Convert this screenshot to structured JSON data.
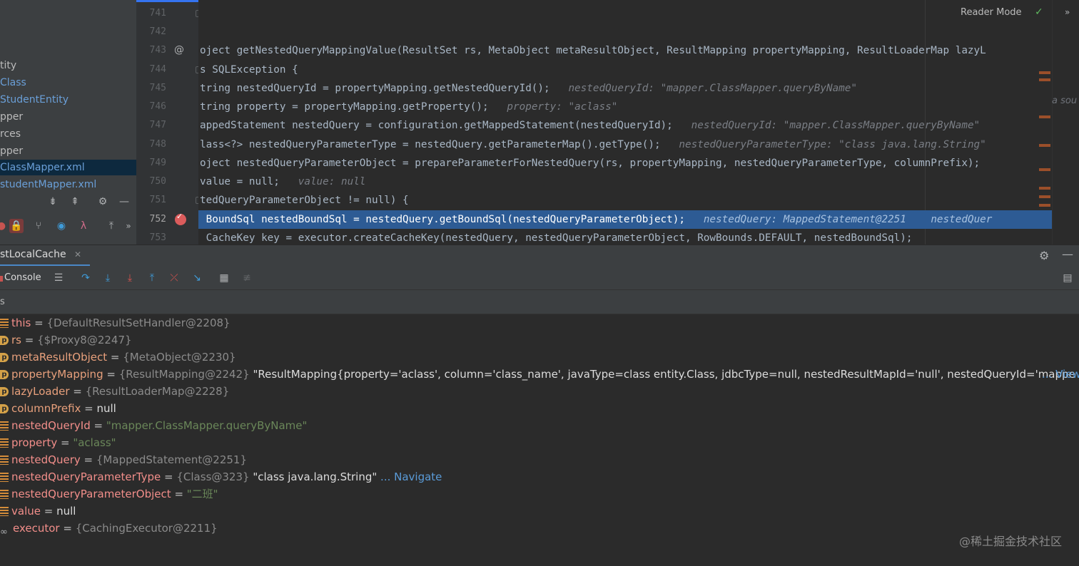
{
  "project_tree": {
    "items": [
      {
        "label": "tity",
        "kind": "plain"
      },
      {
        "label": "Class",
        "kind": "cls"
      },
      {
        "label": "StudentEntity",
        "kind": "cls"
      },
      {
        "label": "pper",
        "kind": "plain"
      },
      {
        "label": "rces",
        "kind": "plain"
      },
      {
        "label": "pper",
        "kind": "plain"
      },
      {
        "label": "ClassMapper.xml",
        "kind": "cls"
      },
      {
        "label": "studentMapper.xml",
        "kind": "cls"
      }
    ]
  },
  "editor": {
    "reader_mode": "Reader Mode",
    "right_hint": "a sou",
    "line_numbers": [
      "741",
      "742",
      "743",
      "744",
      "745",
      "746",
      "747",
      "748",
      "749",
      "750",
      "751",
      "752",
      "753"
    ],
    "lines": [
      "",
      "",
      "oject getNestedQueryMappingValue(ResultSet rs, MetaObject metaResultObject, ResultMapping propertyMapping, ResultLoaderMap lazyL",
      "s SQLException {",
      "tring nestedQueryId = propertyMapping.getNestedQueryId();",
      "tring property = propertyMapping.getProperty();",
      "appedStatement nestedQuery = configuration.getMappedStatement(nestedQueryId);",
      "lass<?> nestedQueryParameterType = nestedQuery.getParameterMap().getType();",
      "oject nestedQueryParameterObject = prepareParameterForNestedQuery(rs, propertyMapping, nestedQueryParameterType, columnPrefix);",
      "value = null;",
      "tedQueryParameterObject != null) {",
      " BoundSql nestedBoundSql = nestedQuery.getBoundSql(nestedQueryParameterObject);",
      " CacheKey key = executor.createCacheKey(nestedQuery, nestedQueryParameterObject, RowBounds.DEFAULT, nestedBoundSql);"
    ],
    "hints": {
      "745": "nestedQueryId: \"mapper.ClassMapper.queryByName\"",
      "746": "property: \"aclass\"",
      "747": "nestedQueryId: \"mapper.ClassMapper.queryByName\"",
      "748": "nestedQueryParameterType: \"class java.lang.String\"",
      "750": "value: null",
      "752a": "nestedQuery: MappedStatement@2251",
      "752b": "nestedQuer"
    }
  },
  "debug": {
    "tab_label": "stLocalCache",
    "console_label": "Console",
    "vars_header": "s",
    "variables": [
      {
        "name": "this",
        "type": "{DefaultResultSetHandler@2208}",
        "icon": "field"
      },
      {
        "name": "rs",
        "type": "{$Proxy8@2247}",
        "icon": "param"
      },
      {
        "name": "metaResultObject",
        "type": "{MetaObject@2230}",
        "icon": "param"
      },
      {
        "name": "propertyMapping",
        "type": "{ResultMapping@2242}",
        "icon": "param",
        "text": "\"ResultMapping{property='aclass', column='class_name', javaType=class entity.Class, jdbcType=null, nestedResultMapId='null', nestedQueryId='mappe",
        "link": "... View"
      },
      {
        "name": "lazyLoader",
        "type": "{ResultLoaderMap@2228}",
        "icon": "param"
      },
      {
        "name": "columnPrefix",
        "value": "null",
        "icon": "param"
      },
      {
        "name": "nestedQueryId",
        "string": "\"mapper.ClassMapper.queryByName\"",
        "icon": "field"
      },
      {
        "name": "property",
        "string": "\"aclass\"",
        "icon": "field"
      },
      {
        "name": "nestedQuery",
        "type": "{MappedStatement@2251}",
        "icon": "field"
      },
      {
        "name": "nestedQueryParameterType",
        "type": "{Class@323}",
        "icon": "field",
        "text": "\"class java.lang.String\"",
        "link": "... Navigate"
      },
      {
        "name": "nestedQueryParameterObject",
        "string": "\"二班\"",
        "icon": "field"
      },
      {
        "name": "value",
        "value": "null",
        "icon": "field"
      },
      {
        "name": "executor",
        "type": "{CachingExecutor@2211}",
        "icon": "watch"
      }
    ]
  },
  "watermark": "@稀土掘金技术社区"
}
